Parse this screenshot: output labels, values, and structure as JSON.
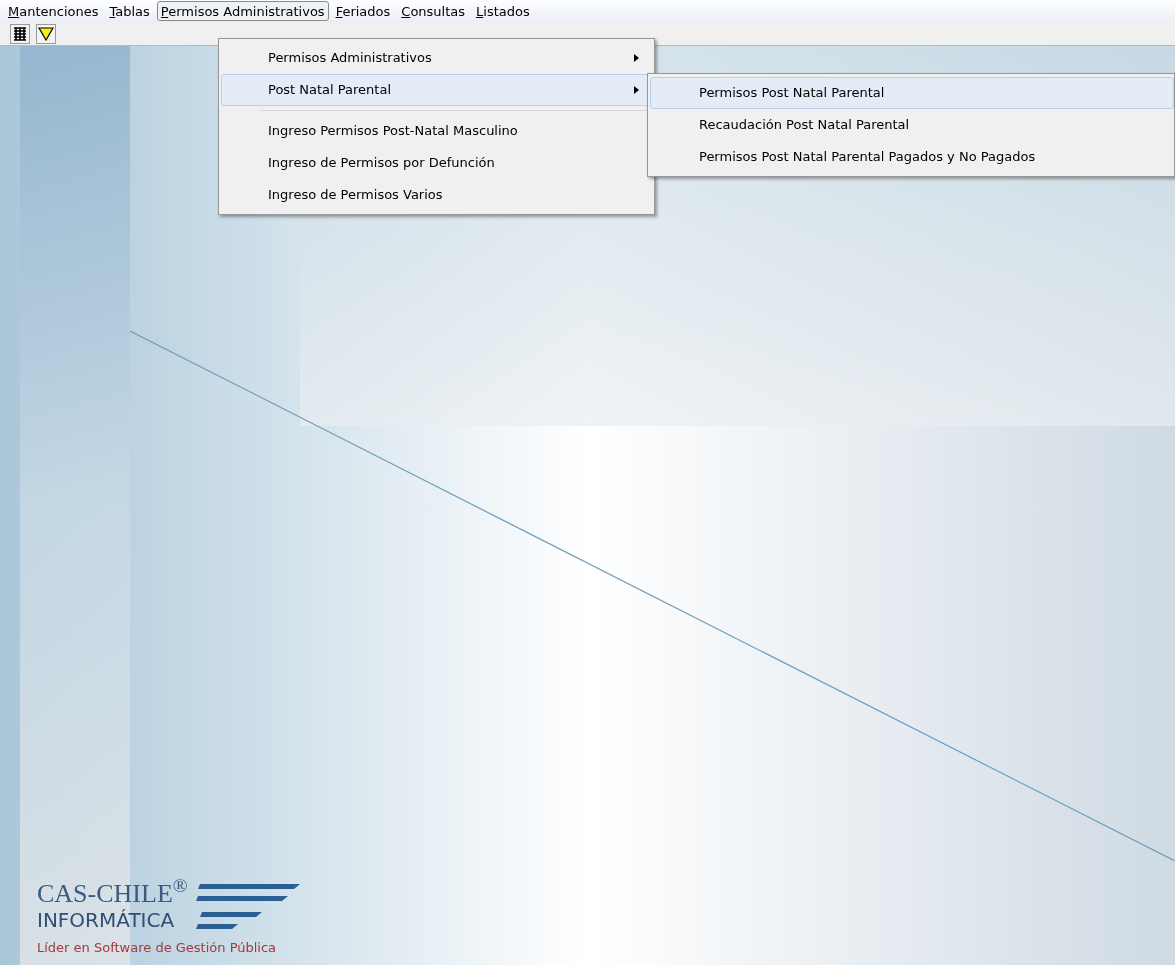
{
  "menu_bar": [
    {
      "label": "Mantenciones",
      "selected": false
    },
    {
      "label": "Tablas",
      "selected": false
    },
    {
      "label": "Permisos Administrativos",
      "selected": true
    },
    {
      "label": "Feriados",
      "selected": false
    },
    {
      "label": "Consultas",
      "selected": false
    },
    {
      "label": "Listados",
      "selected": false
    }
  ],
  "dropdown": [
    {
      "kind": "item",
      "label": "Permisos Administrativos",
      "submenu": true,
      "selected": false
    },
    {
      "kind": "item",
      "label": "Post Natal Parental",
      "submenu": true,
      "selected": true
    },
    {
      "kind": "separator"
    },
    {
      "kind": "item",
      "label": "Ingreso Permisos Post-Natal Masculino",
      "submenu": false,
      "selected": false
    },
    {
      "kind": "item",
      "label": "Ingreso de Permisos por Defunción",
      "submenu": false,
      "selected": false
    },
    {
      "kind": "item",
      "label": "Ingreso de Permisos Varios",
      "submenu": false,
      "selected": false
    }
  ],
  "submenu": [
    {
      "label": "Permisos Post Natal Parental",
      "selected": true
    },
    {
      "label": "Recaudación Post Natal Parental",
      "selected": false
    },
    {
      "label": "Permisos Post Natal Parental Pagados y No Pagados",
      "selected": false
    }
  ],
  "logo": {
    "name": "CAS-CHILE$^{®}$",
    "subtitle": "INFORMÁTICA",
    "tagline": "Líder en Software de Gestión Pública"
  }
}
